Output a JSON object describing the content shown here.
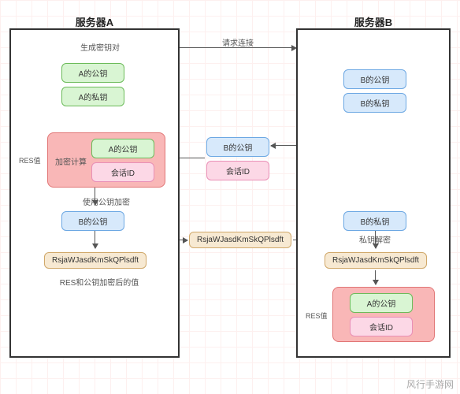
{
  "serverA": {
    "title": "服务器A",
    "gen_keys": "生成密钥对",
    "a_pub": "A的公钥",
    "a_priv": "A的私钥",
    "res_label": "RES值",
    "compute": "加密计算",
    "inner_a_pub": "A的公钥",
    "inner_session": "会话ID",
    "use_pubkey": "使用公钥加密",
    "b_pub": "B的公钥",
    "cipher": "RsjaWJasdKmSkQPlsdft",
    "res_cipher_lbl": "RES和公钥加密后的值"
  },
  "serverB": {
    "title": "服务器B",
    "b_pub": "B的公钥",
    "b_priv": "B的私钥",
    "b_priv2": "B的私钥",
    "priv_decrypt": "私钥解密",
    "cipher": "RsjaWJasdKmSkQPlsdft",
    "res_label": "RES值",
    "inner_a_pub": "A的公钥",
    "inner_session": "会话ID"
  },
  "midA": {
    "b_pub": "B的公钥",
    "session": "会话ID"
  },
  "midB": {
    "cipher": "RsjaWJasdKmSkQPlsdft"
  },
  "arrows": {
    "req": "请求连接"
  },
  "watermark": "风行手游网"
}
